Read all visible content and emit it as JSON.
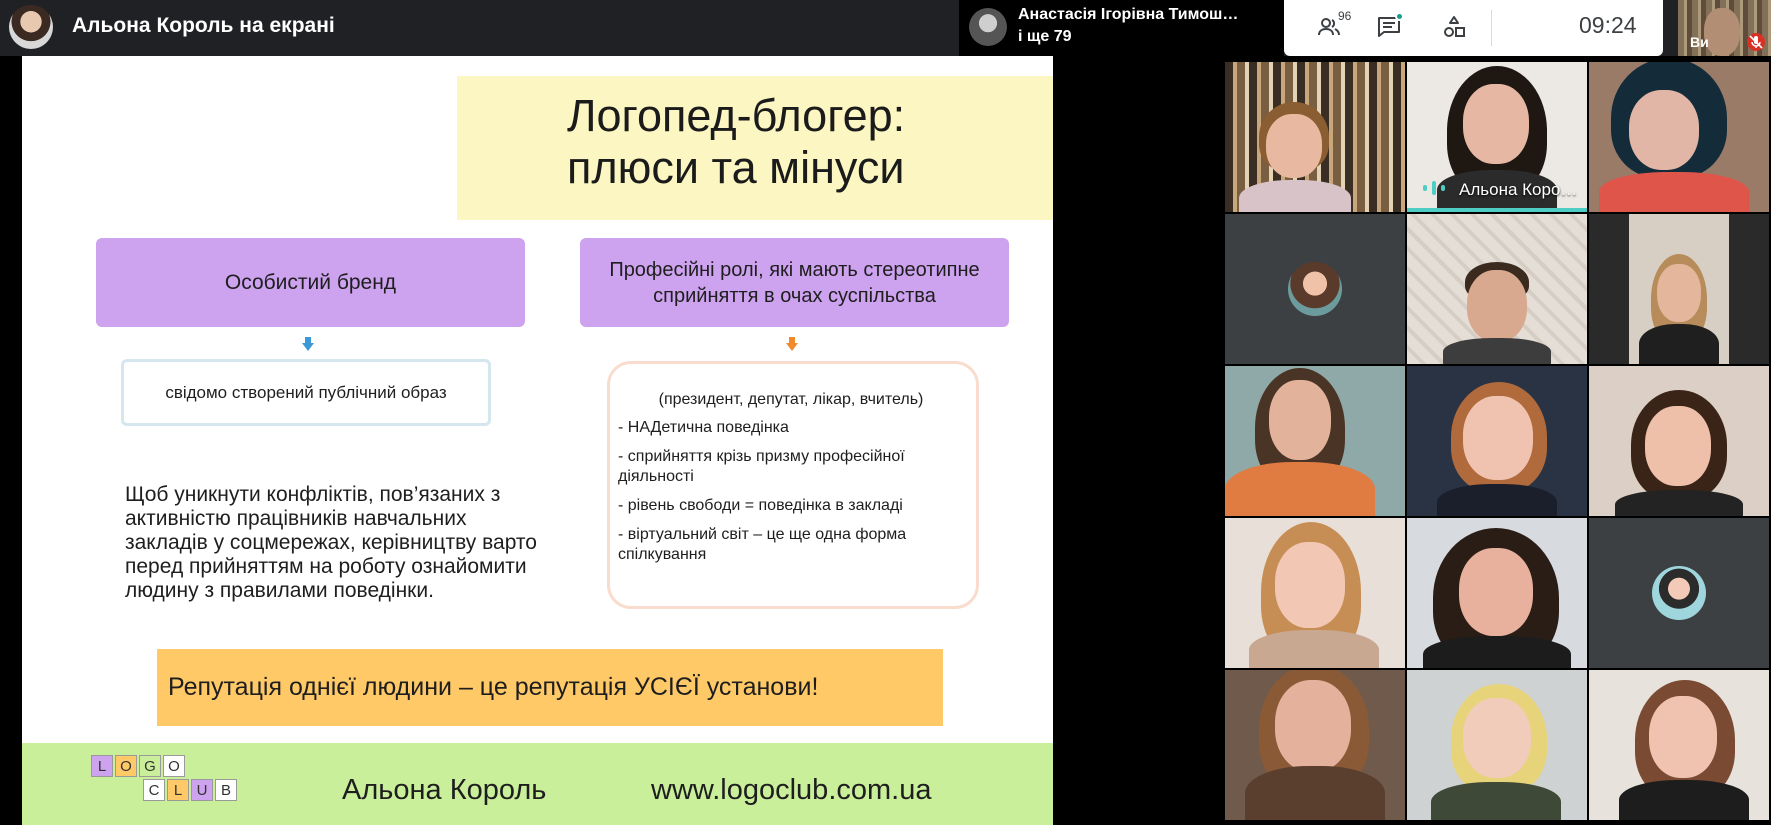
{
  "meeting": {
    "presenting_title": "Альона Король на екрані",
    "pinned_participant": "Анастасія Ігорівна Тимош…",
    "pinned_more": "і ще 79",
    "participants_count": "96",
    "clock": "09:24",
    "self_label": "Ви",
    "colors": {
      "topbar": "#202124",
      "speaking_indicator": "#4ecdc4",
      "chat_dot": "#1a9c8f"
    }
  },
  "controls": {
    "people_icon": "people-icon",
    "chat_icon": "chat-icon",
    "activities_icon": "activities-icon"
  },
  "slide": {
    "title": "Логопед-блогер:\nплюси та мінуси",
    "left_box": "Особистий бренд",
    "right_box": "Професійні ролі, які мають стереотипне сприйняття в очах суспільства",
    "left_detail": "свідомо створений публічний образ",
    "roles_heading": "(президент, депутат, лікар, вчитель)",
    "roles_items": [
      "- НАДетична поведінка",
      "- сприйняття крізь призму професійної діяльності",
      "- рівень свободи = поведінка в закладі",
      "- віртуальний світ – це ще одна форма спілкування"
    ],
    "conflict_text": "Щоб уникнути конфліктів, пов’язаних з активністю працівників навчальних закладів у соцмережах, керівництву варто перед прийняттям на роботу ознайомити людину з правилами поведінки.",
    "reputation": "Репутація однієї людини – це репутація УСІЄЇ установи!",
    "logo_letters_row1": [
      "L",
      "O",
      "G",
      "O"
    ],
    "logo_letters_row2": [
      "C",
      "L",
      "U",
      "B"
    ],
    "footer_name": "Альона Король",
    "footer_url": "www.logoclub.com.ua",
    "colors": {
      "title_bg": "#fcf7c2",
      "purple_box": "#cda2ef",
      "reputation_bg": "#ffc967",
      "footer_bg": "#c9ef9b",
      "arrow_blue": "#3b9ad6",
      "arrow_orange": "#f08a2c"
    }
  },
  "participants": {
    "speaking_name": "Альона Коро…"
  }
}
